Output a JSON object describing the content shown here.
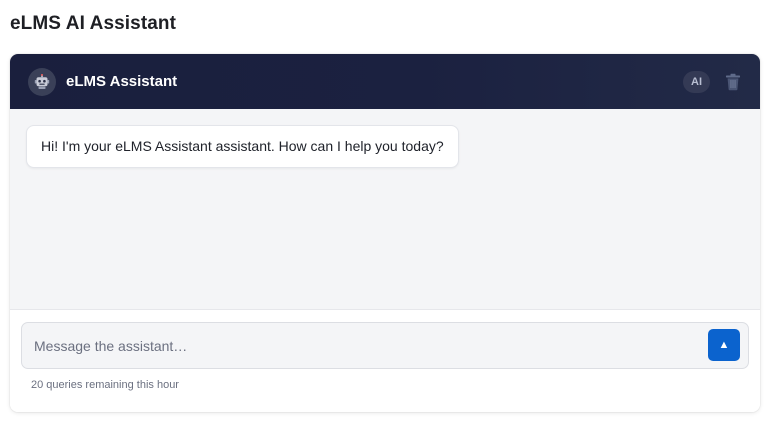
{
  "page": {
    "title": "eLMS AI Assistant"
  },
  "header": {
    "avatar_icon": "robot-icon",
    "title": "eLMS Assistant",
    "badge": "AI",
    "clear_icon": "trash-icon"
  },
  "messages": [
    {
      "role": "assistant",
      "text": "Hi! I'm your eLMS Assistant assistant. How can I help you today?"
    }
  ],
  "composer": {
    "placeholder": "Message the assistant…",
    "value": "",
    "send_label": "▲",
    "send_icon": "send-arrow-icon",
    "quota": "20 queries remaining this hour"
  },
  "colors": {
    "header_bg": "#1a1f3d",
    "accent": "#0b63ce",
    "messages_bg": "#f4f5f7"
  }
}
